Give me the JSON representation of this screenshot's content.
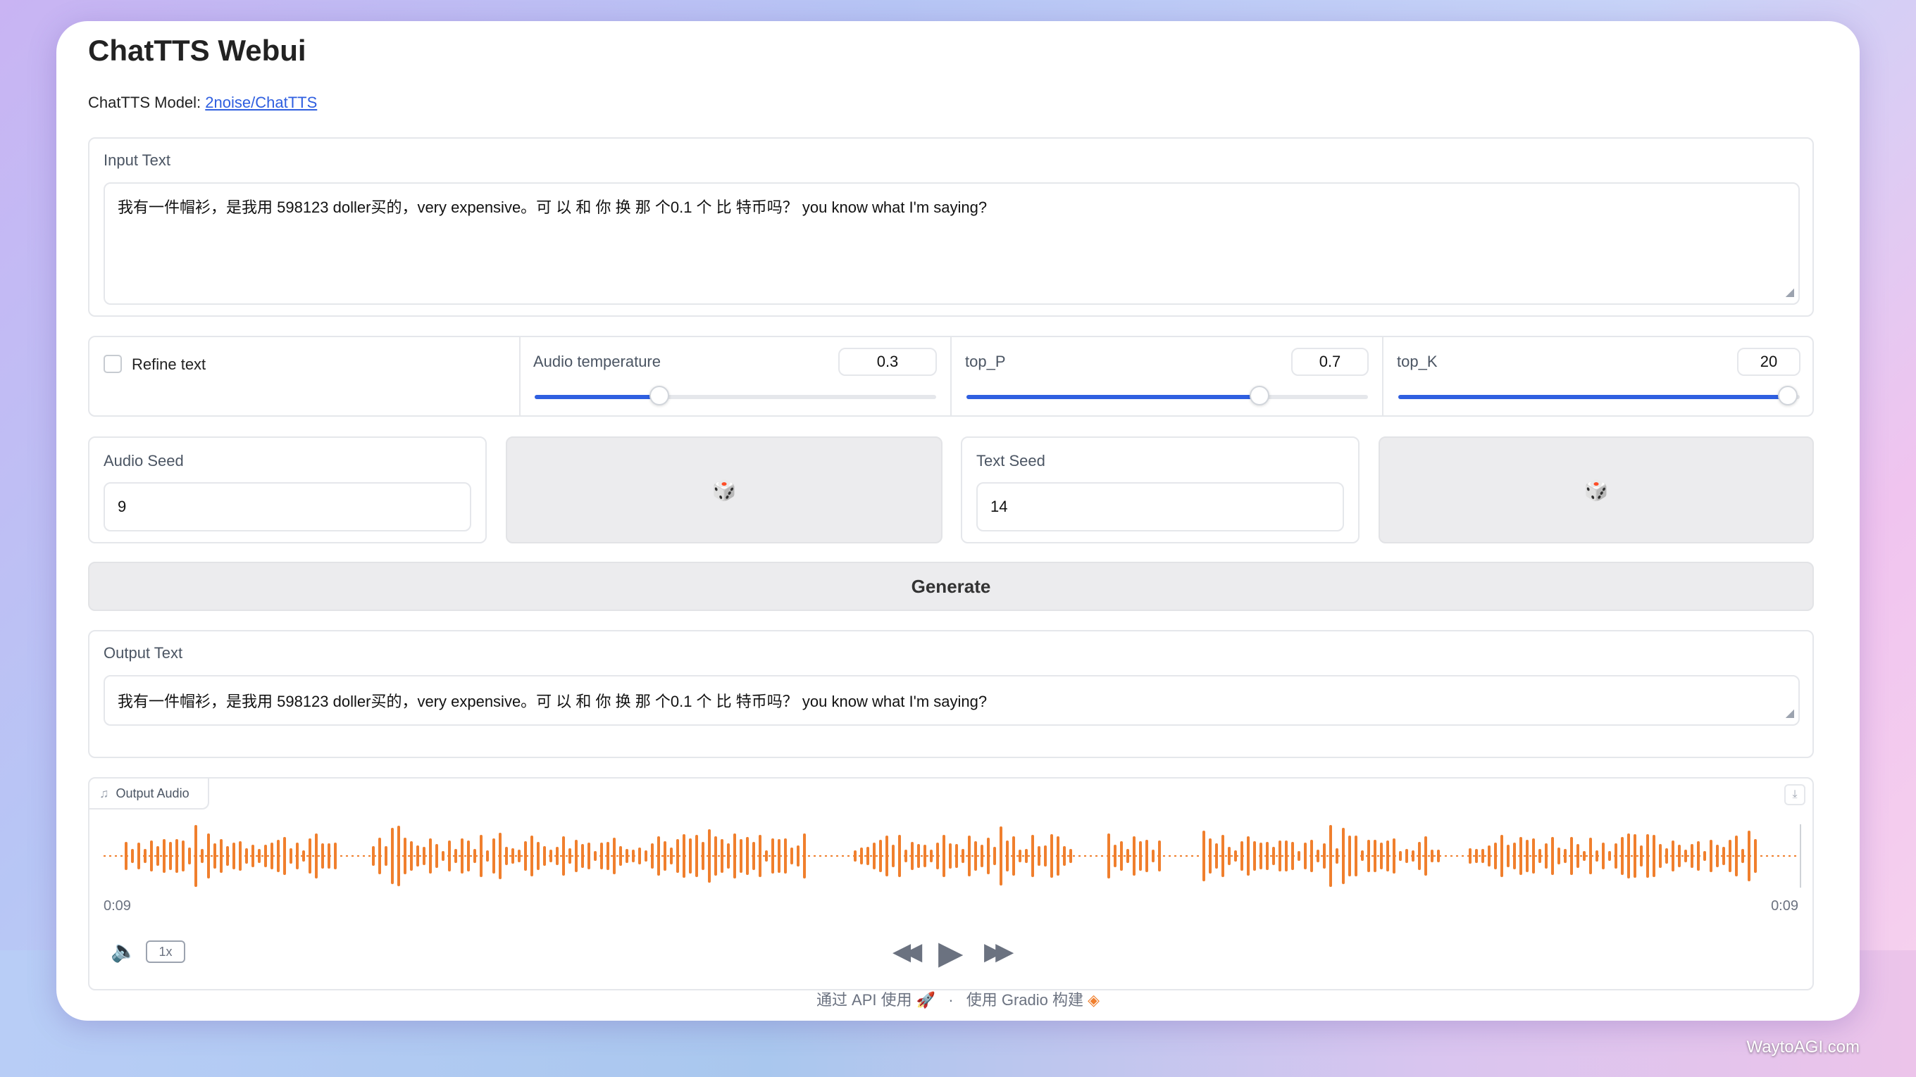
{
  "app": {
    "title": "ChatTTS Webui",
    "model_label": "ChatTTS Model:",
    "model_link": "2noise/ChatTTS"
  },
  "input": {
    "label": "Input Text",
    "value": "我有一件帽衫，是我用 598123 doller买的，very expensive。可 以 和 你 换 那 个0.1 个 比 特币吗？ you know what I'm saying?"
  },
  "controls": {
    "refine_text_label": "Refine text",
    "refine_text_checked": false,
    "audio_temperature": {
      "label": "Audio temperature",
      "value": "0.3",
      "fraction": 0.31
    },
    "top_p": {
      "label": "top_P",
      "value": "0.7",
      "fraction": 0.73
    },
    "top_k": {
      "label": "top_K",
      "value": "20",
      "fraction": 0.97
    }
  },
  "seeds": {
    "audio_seed_label": "Audio Seed",
    "audio_seed_value": "9",
    "text_seed_label": "Text Seed",
    "text_seed_value": "14",
    "dice_icon": "dice-icon",
    "dice_glyph": "🎲"
  },
  "generate_label": "Generate",
  "output": {
    "label": "Output Text",
    "value": "我有一件帽衫，是我用 598123 doller买的，very expensive。可 以 和 你 换 那 个0.1 个 比 特币吗？ you know what I'm saying?"
  },
  "audio": {
    "label": "Output Audio",
    "time_start": "0:09",
    "time_end": "0:09",
    "speed": "1x",
    "wave_color": "#f07f2d"
  },
  "footer": {
    "api_text": "通过 API 使用",
    "sep": "·",
    "gradio_text": "使用 Gradio 构建"
  },
  "watermark": "WaytoAGI.com",
  "colors": {
    "accent": "#2f5fe0",
    "wave": "#f07f2d"
  }
}
